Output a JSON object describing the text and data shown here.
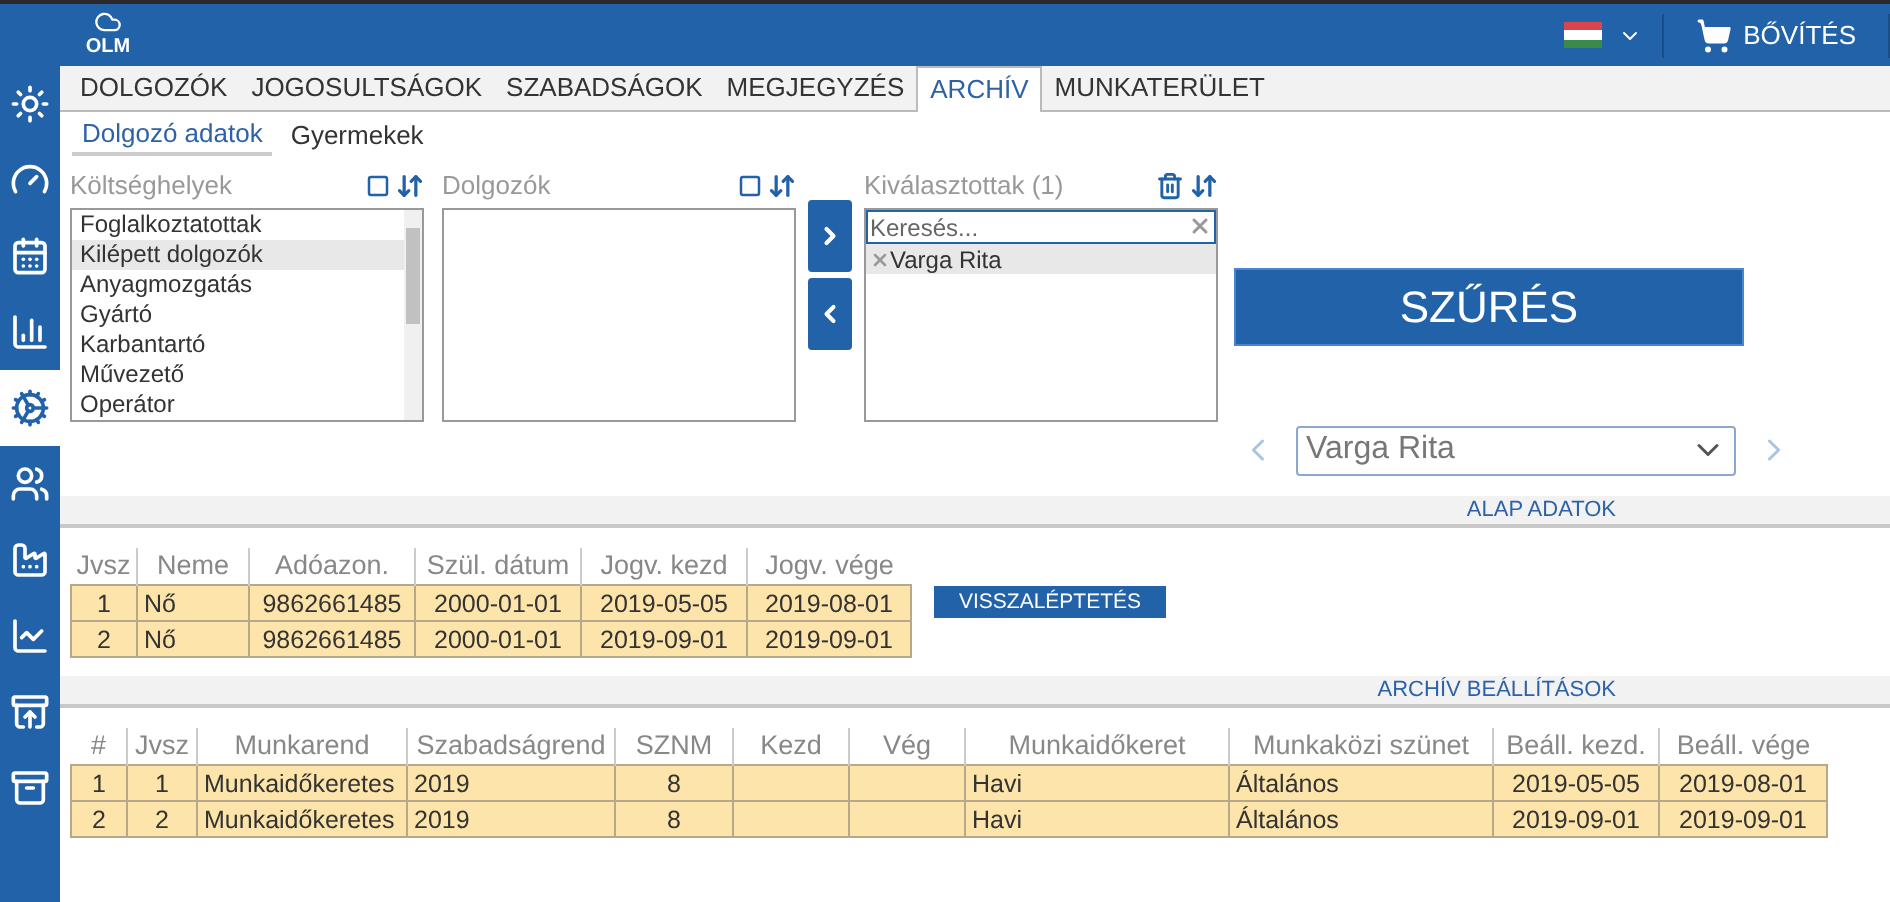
{
  "header": {
    "logo": "OLM",
    "upgrade": "BŐVÍTÉS"
  },
  "sidebar": [
    {
      "kind": "sun",
      "selected": false
    },
    {
      "kind": "gauge",
      "selected": false
    },
    {
      "kind": "calendar",
      "selected": false
    },
    {
      "kind": "bars",
      "selected": false
    },
    {
      "kind": "cogs",
      "selected": true
    },
    {
      "kind": "people",
      "selected": false
    },
    {
      "kind": "factory",
      "selected": false
    },
    {
      "kind": "chart",
      "selected": false
    },
    {
      "kind": "download",
      "selected": false
    },
    {
      "kind": "upload",
      "selected": false
    }
  ],
  "tabs": [
    {
      "label": "DOLGOZÓK",
      "selected": false
    },
    {
      "label": "JOGOSULTSÁGOK",
      "selected": false
    },
    {
      "label": "SZABADSÁGOK",
      "selected": false
    },
    {
      "label": "MEGJEGYZÉS",
      "selected": false
    },
    {
      "label": "ARCHÍV",
      "selected": true
    },
    {
      "label": "MUNKATERÜLET",
      "selected": false
    }
  ],
  "subtabs": [
    {
      "label": "Dolgozó adatok",
      "selected": true
    },
    {
      "label": "Gyermekek",
      "selected": false
    }
  ],
  "cost_centers": {
    "title": "Költséghelyek",
    "checked": false,
    "items": [
      {
        "label": "Foglalkoztatottak",
        "selected": false
      },
      {
        "label": "Kilépett dolgozók",
        "selected": true
      },
      {
        "label": "Anyagmozgatás",
        "selected": false
      },
      {
        "label": "Gyártó",
        "selected": false
      },
      {
        "label": "Karbantartó",
        "selected": false
      },
      {
        "label": "Művezető",
        "selected": false
      },
      {
        "label": "Operátor",
        "selected": false
      }
    ]
  },
  "employees": {
    "title": "Dolgozók",
    "checked": false
  },
  "chosen": {
    "title": "Kiválasztottak (1)",
    "placeholder": "Keresés...",
    "items": [
      "Varga Rita"
    ]
  },
  "filter_button": "SZŰRÉS",
  "employee_select": {
    "value": "Varga Rita"
  },
  "basic": {
    "title": "ALAP ADATOK",
    "button": "VISSZALÉPTETÉS",
    "columns": [
      "Jvsz",
      "Neme",
      "Adóazon.",
      "Szül. dátum",
      "Jogv. kezd",
      "Jogv. vége"
    ],
    "rows": [
      [
        "1",
        "Nő",
        "9862661485",
        "2000-01-01",
        "2019-05-05",
        "2019-08-01"
      ],
      [
        "2",
        "Nő",
        "9862661485",
        "2000-01-01",
        "2019-09-01",
        "2019-09-01"
      ]
    ]
  },
  "archive": {
    "title": "ARCHÍV BEÁLLÍTÁSOK",
    "columns": [
      "#",
      "Jvsz",
      "Munkarend",
      "Szabadságrend",
      "SZNM",
      "Kezd",
      "Vég",
      "Munkaidőkeret",
      "Munkaközi szünet",
      "Beáll. kezd.",
      "Beáll. vége"
    ],
    "rows": [
      [
        "1",
        "1",
        "Munkaidőkeretes",
        "2019",
        "8",
        "",
        "",
        "Havi",
        "Általános",
        "2019-05-05",
        "2019-08-01"
      ],
      [
        "2",
        "2",
        "Munkaidőkeretes",
        "2019",
        "8",
        "",
        "",
        "Havi",
        "Általános",
        "2019-09-01",
        "2019-09-01"
      ]
    ]
  }
}
